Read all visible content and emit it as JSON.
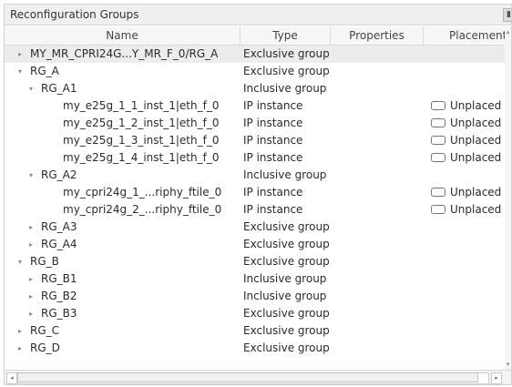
{
  "panel": {
    "title": "Reconfiguration Groups",
    "float_glyph": "▮"
  },
  "columns": {
    "name": "Name",
    "type": "Type",
    "properties": "Properties",
    "placement": "Placement"
  },
  "icons": {
    "collapsed": "▸",
    "expanded": "▾",
    "placement": "placement-box-icon"
  },
  "rows": [
    {
      "level": 0,
      "expander": "collapsed",
      "name": "MY_MR_CPRI24G...Y_MR_F_0/RG_A",
      "type": "Exclusive group",
      "placement": "",
      "selected": true
    },
    {
      "level": 0,
      "expander": "expanded",
      "name": "RG_A",
      "type": "Exclusive group",
      "placement": ""
    },
    {
      "level": 1,
      "expander": "expanded",
      "name": "RG_A1",
      "type": "Inclusive group",
      "placement": ""
    },
    {
      "level": 2,
      "expander": "none",
      "name": "my_e25g_1_1_inst_1|eth_f_0",
      "type": "IP instance",
      "placement": "Unplaced"
    },
    {
      "level": 2,
      "expander": "none",
      "name": "my_e25g_1_2_inst_1|eth_f_0",
      "type": "IP instance",
      "placement": "Unplaced"
    },
    {
      "level": 2,
      "expander": "none",
      "name": "my_e25g_1_3_inst_1|eth_f_0",
      "type": "IP instance",
      "placement": "Unplaced"
    },
    {
      "level": 2,
      "expander": "none",
      "name": "my_e25g_1_4_inst_1|eth_f_0",
      "type": "IP instance",
      "placement": "Unplaced"
    },
    {
      "level": 1,
      "expander": "expanded",
      "name": "RG_A2",
      "type": "Inclusive group",
      "placement": ""
    },
    {
      "level": 2,
      "expander": "none",
      "name": "my_cpri24g_1_...riphy_ftile_0",
      "type": "IP instance",
      "placement": "Unplaced"
    },
    {
      "level": 2,
      "expander": "none",
      "name": "my_cpri24g_2_...riphy_ftile_0",
      "type": "IP instance",
      "placement": "Unplaced"
    },
    {
      "level": 1,
      "expander": "collapsed",
      "name": "RG_A3",
      "type": "Exclusive group",
      "placement": ""
    },
    {
      "level": 1,
      "expander": "collapsed",
      "name": "RG_A4",
      "type": "Exclusive group",
      "placement": ""
    },
    {
      "level": 0,
      "expander": "expanded",
      "name": "RG_B",
      "type": "Exclusive group",
      "placement": ""
    },
    {
      "level": 1,
      "expander": "collapsed",
      "name": "RG_B1",
      "type": "Inclusive group",
      "placement": ""
    },
    {
      "level": 1,
      "expander": "collapsed",
      "name": "RG_B2",
      "type": "Inclusive group",
      "placement": ""
    },
    {
      "level": 1,
      "expander": "collapsed",
      "name": "RG_B3",
      "type": "Exclusive group",
      "placement": ""
    },
    {
      "level": 0,
      "expander": "collapsed",
      "name": "RG_C",
      "type": "Exclusive group",
      "placement": ""
    },
    {
      "level": 0,
      "expander": "collapsed",
      "name": "RG_D",
      "type": "Exclusive group",
      "placement": ""
    }
  ],
  "scrollbars": {
    "up": "▴",
    "down": "▾",
    "left": "◂",
    "right": "▸"
  }
}
